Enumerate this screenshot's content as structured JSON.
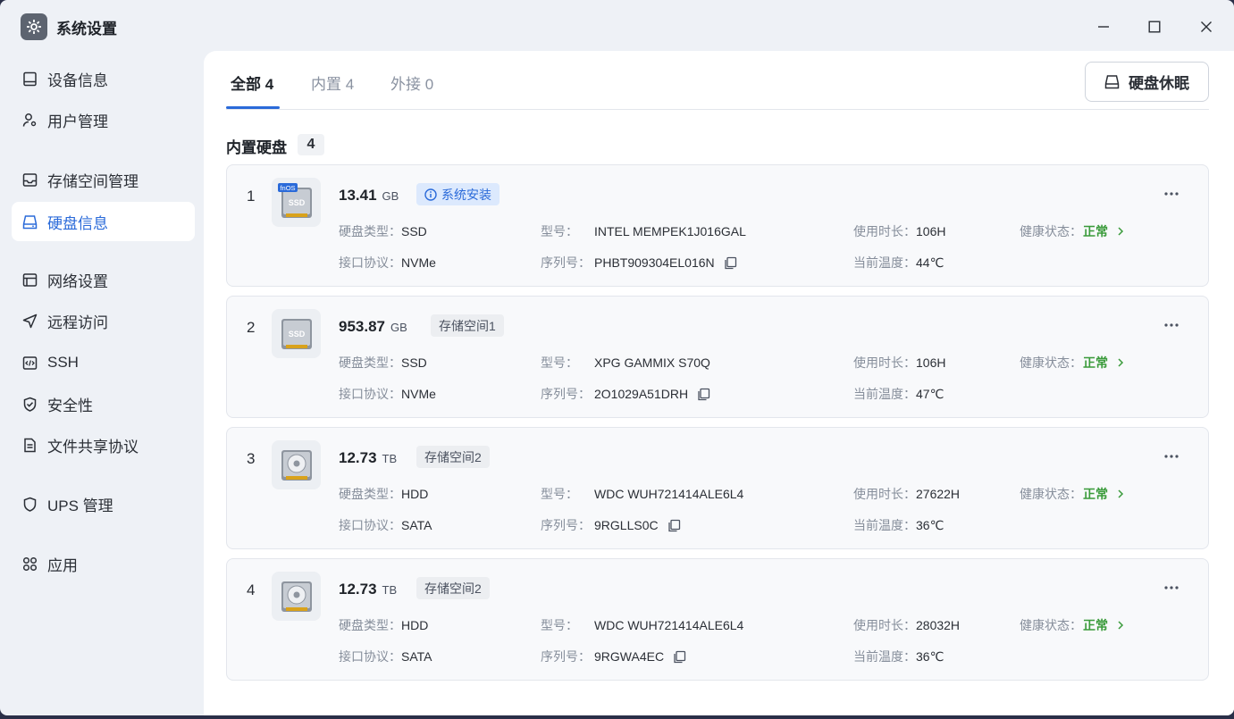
{
  "window": {
    "title": "系统设置"
  },
  "sidebar": {
    "items": [
      {
        "label": "设备信息",
        "icon": "monitor-icon"
      },
      {
        "label": "用户管理",
        "icon": "user-gear-icon"
      },
      {
        "label": "存储空间管理",
        "icon": "inbox-icon"
      },
      {
        "label": "硬盘信息",
        "icon": "hard-drive-icon"
      },
      {
        "label": "网络设置",
        "icon": "network-icon"
      },
      {
        "label": "远程访问",
        "icon": "send-icon"
      },
      {
        "label": "SSH",
        "icon": "code-icon"
      },
      {
        "label": "安全性",
        "icon": "shield-check-icon"
      },
      {
        "label": "文件共享协议",
        "icon": "document-icon"
      },
      {
        "label": "UPS 管理",
        "icon": "shield-icon"
      },
      {
        "label": "应用",
        "icon": "apps-icon"
      }
    ],
    "active_index": 3
  },
  "tabs": [
    {
      "label": "全部 4"
    },
    {
      "label": "内置 4"
    },
    {
      "label": "外接 0"
    }
  ],
  "sleep_button": {
    "label": "硬盘休眠"
  },
  "section": {
    "title": "内置硬盘",
    "count": "4"
  },
  "field_labels": {
    "type": "硬盘类型：",
    "model": "型号：",
    "usage": "使用时长：",
    "health": "健康状态：",
    "interface": "接口协议：",
    "serial": "序列号：",
    "temp": "当前温度："
  },
  "disks": [
    {
      "index": "1",
      "capacity": "13.41",
      "unit": "GB",
      "badge": "系统安装",
      "badge_style": "info",
      "thumb_brand": "fnOS",
      "thumb_kind": "SSD",
      "type": "SSD",
      "model": "INTEL MEMPEK1J016GAL",
      "usage": "106H",
      "health": "正常",
      "interface": "NVMe",
      "serial": "PHBT909304EL016N",
      "temp": "44℃"
    },
    {
      "index": "2",
      "capacity": "953.87",
      "unit": "GB",
      "badge": "存储空间1",
      "badge_style": "grey",
      "thumb_kind": "SSD",
      "type": "SSD",
      "model": "XPG GAMMIX S70Q",
      "usage": "106H",
      "health": "正常",
      "interface": "NVMe",
      "serial": "2O1029A51DRH",
      "temp": "47℃"
    },
    {
      "index": "3",
      "capacity": "12.73",
      "unit": "TB",
      "badge": "存储空间2",
      "badge_style": "grey",
      "thumb_kind": "HDD",
      "type": "HDD",
      "model": "WDC WUH721414ALE6L4",
      "usage": "27622H",
      "health": "正常",
      "interface": "SATA",
      "serial": "9RGLLS0C",
      "temp": "36℃"
    },
    {
      "index": "4",
      "capacity": "12.73",
      "unit": "TB",
      "badge": "存储空间2",
      "badge_style": "grey",
      "thumb_kind": "HDD",
      "type": "HDD",
      "model": "WDC WUH721414ALE6L4",
      "usage": "28032H",
      "health": "正常",
      "interface": "SATA",
      "serial": "9RGWA4EC",
      "temp": "36℃"
    }
  ],
  "colors": {
    "accent": "#2a6ad9",
    "healthy": "#3a9b3b"
  }
}
